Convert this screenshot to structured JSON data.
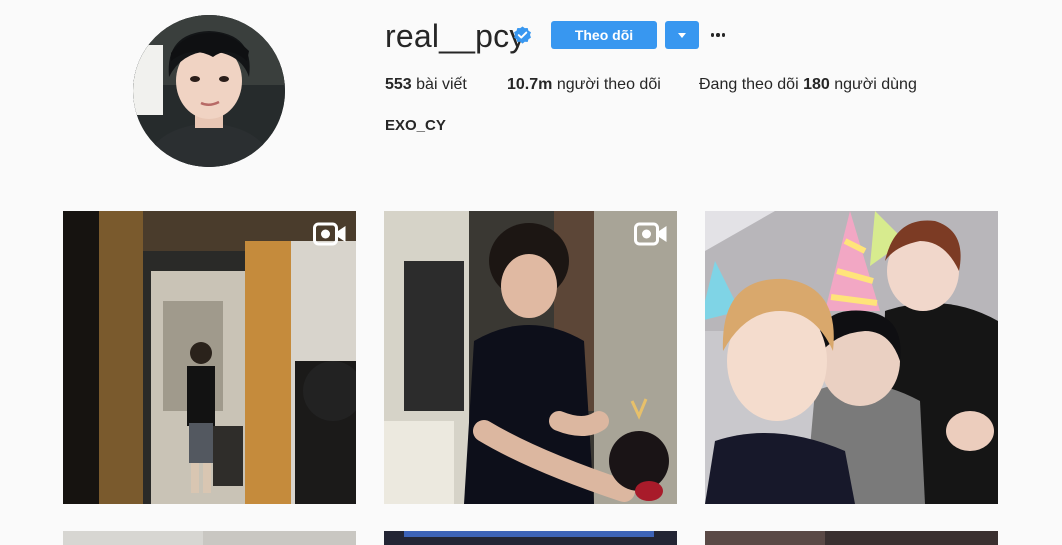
{
  "profile": {
    "username": "real__pcy",
    "verified": true,
    "follow_label": "Theo dõi",
    "fullname": "EXO_CY",
    "stats": {
      "posts_count": "553",
      "posts_label": "bài viết",
      "followers_count": "10.7m",
      "followers_label": "người theo dõi",
      "following_prefix": "Đang theo dõi",
      "following_count": "180",
      "following_suffix": "người dùng"
    }
  },
  "posts": [
    {
      "type": "video",
      "desc": "person standing in doorway"
    },
    {
      "type": "video",
      "desc": "person in black t-shirt with cake"
    },
    {
      "type": "photo",
      "desc": "three people selfie with party hats"
    }
  ],
  "colors": {
    "accent": "#3897f0",
    "background": "#fafafa",
    "text": "#262626"
  }
}
